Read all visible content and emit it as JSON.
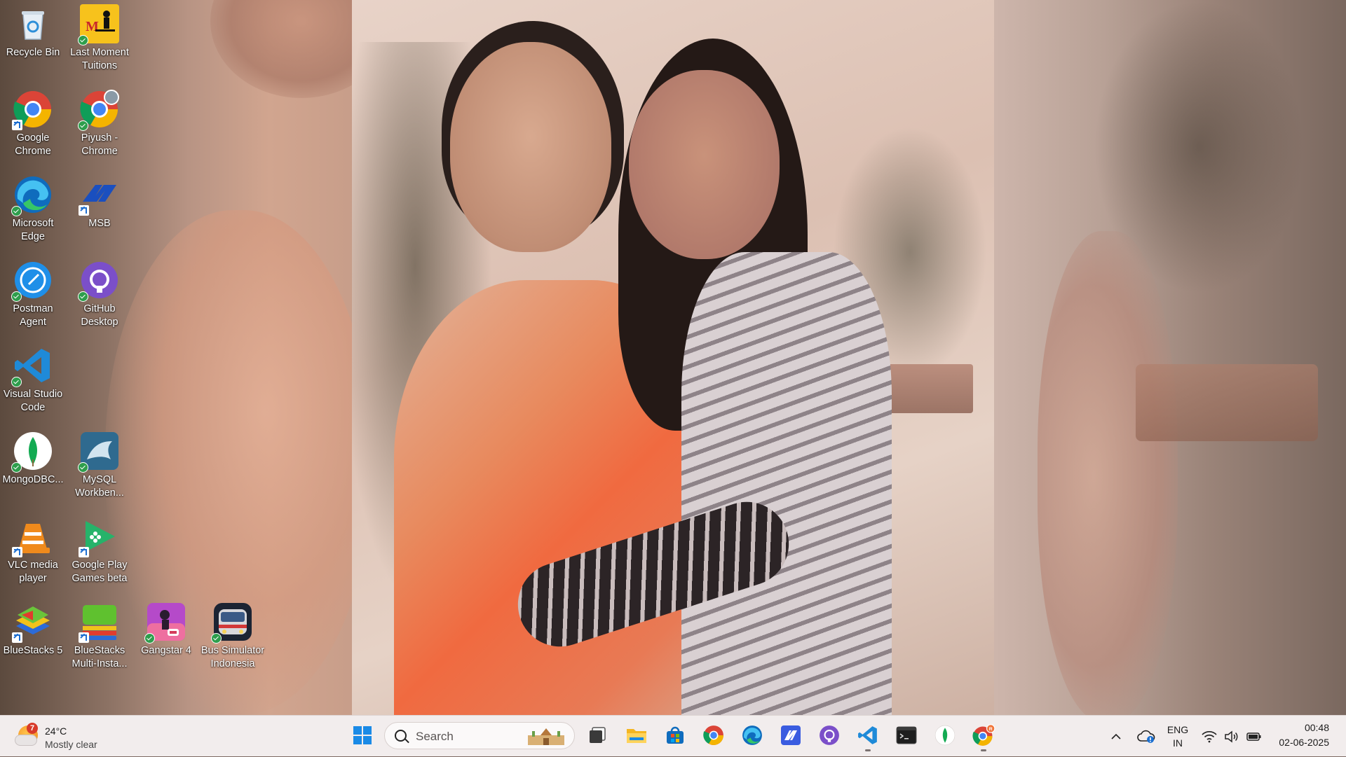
{
  "desktop": {
    "icons": [
      {
        "label": "Recycle Bin"
      },
      {
        "label": "Last Moment Tuitions"
      },
      {
        "label": "Google Chrome"
      },
      {
        "label": "Piyush - Chrome"
      },
      {
        "label": "Microsoft Edge"
      },
      {
        "label": "MSB"
      },
      {
        "label": "Postman Agent"
      },
      {
        "label": "GitHub Desktop"
      },
      {
        "label": "Visual Studio Code"
      },
      {
        "label": "MongoDBC..."
      },
      {
        "label": "MySQL Workben..."
      },
      {
        "label": "VLC media player"
      },
      {
        "label": "Google Play Games beta"
      },
      {
        "label": "BlueStacks 5"
      },
      {
        "label": "BlueStacks Multi-Insta..."
      },
      {
        "label": "Gangstar 4"
      },
      {
        "label": "Bus Simulator Indonesia"
      }
    ]
  },
  "taskbar": {
    "weather": {
      "badge": "7",
      "temp": "24°C",
      "condition": "Mostly clear"
    },
    "search_label": "Search",
    "apps": [
      {
        "icon": "windows-start-icon"
      },
      {
        "icon": "task-view-icon"
      },
      {
        "icon": "file-explorer-icon"
      },
      {
        "icon": "microsoft-store-icon"
      },
      {
        "icon": "chrome-icon"
      },
      {
        "icon": "edge-icon"
      },
      {
        "icon": "msb-icon"
      },
      {
        "icon": "github-desktop-icon"
      },
      {
        "icon": "vscode-icon"
      },
      {
        "icon": "terminal-icon"
      },
      {
        "icon": "mongodb-compass-icon"
      },
      {
        "icon": "chrome-profile-icon",
        "badge": "R"
      }
    ],
    "tray": {
      "language_top": "ENG",
      "language_bottom": "IN",
      "time": "00:48",
      "date": "02-06-2025"
    }
  },
  "colors": {
    "taskbar_bg": "#f2eded",
    "accent": "#1f6fd1"
  }
}
